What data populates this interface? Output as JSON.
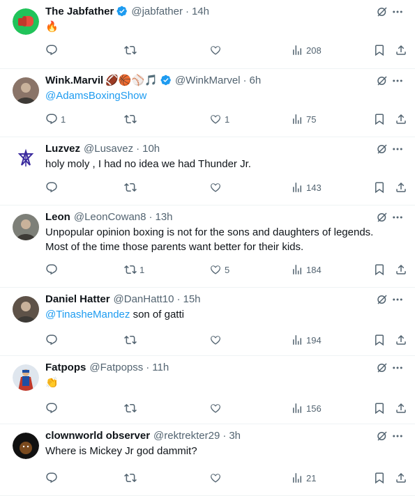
{
  "replies": [
    {
      "name": "The Jabfather",
      "verified": true,
      "handle": "@jabfather",
      "time": "14h",
      "text": [
        {
          "t": "🔥",
          "mention": false
        }
      ],
      "counts": {
        "reply": "",
        "retweet": "",
        "like": "",
        "views": "208"
      },
      "avatar_color": "#21c35a",
      "avatar_icon": "boxing-glove-icon"
    },
    {
      "name": "Wink.Marvil",
      "name_emojis": "🏈🏀⚾🎵",
      "verified": true,
      "handle": "@WinkMarvel",
      "time": "6h",
      "text": [
        {
          "t": "@AdamsBoxingShow",
          "mention": true
        }
      ],
      "counts": {
        "reply": "1",
        "retweet": "",
        "like": "1",
        "views": "75"
      },
      "avatar_color": "#8a7468",
      "avatar_icon": "photo-avatar"
    },
    {
      "name": "Luzvez",
      "verified": false,
      "handle": "@Lusavez",
      "time": "10h",
      "text": [
        {
          "t": "holy moly , I had no idea we had Thunder Jr.",
          "mention": false
        }
      ],
      "counts": {
        "reply": "",
        "retweet": "",
        "like": "",
        "views": "143"
      },
      "avatar_color": "#ffffff",
      "avatar_icon": "star-sigil-icon"
    },
    {
      "name": "Leon",
      "verified": false,
      "handle": "@LeonCowan8",
      "time": "13h",
      "text": [
        {
          "t": "Unpopular opinion boxing is not for the sons and daughters of legends. Most of the time those parents want better for their kids.",
          "mention": false
        }
      ],
      "counts": {
        "reply": "",
        "retweet": "1",
        "like": "5",
        "views": "184"
      },
      "avatar_color": "#7d7f78",
      "avatar_icon": "photo-avatar"
    },
    {
      "name": "Daniel Hatter",
      "verified": false,
      "handle": "@DanHatt10",
      "time": "15h",
      "text": [
        {
          "t": "@TinasheMandez",
          "mention": true
        },
        {
          "t": " son of gatti",
          "mention": false
        }
      ],
      "counts": {
        "reply": "",
        "retweet": "",
        "like": "",
        "views": "194"
      },
      "avatar_color": "#5e5248",
      "avatar_icon": "photo-avatar"
    },
    {
      "name": "Fatpops",
      "verified": false,
      "handle": "@Fatpopss",
      "time": "11h",
      "text": [
        {
          "t": "👏",
          "mention": false
        }
      ],
      "counts": {
        "reply": "",
        "retweet": "",
        "like": "",
        "views": "156"
      },
      "avatar_color": "#dfe6ee",
      "avatar_icon": "superhero-avatar"
    },
    {
      "name": "clownworld observer",
      "verified": false,
      "handle": "@rektrekter29",
      "time": "3h",
      "text": [
        {
          "t": "Where is Mickey Jr god dammit?",
          "mention": false
        }
      ],
      "counts": {
        "reply": "",
        "retweet": "",
        "like": "",
        "views": "21"
      },
      "avatar_color": "#111111",
      "avatar_icon": "dark-avatar"
    }
  ],
  "colors": {
    "text": "#0f1419",
    "muted": "#536471",
    "link": "#1d9bf0",
    "verified": "#1d9bf0",
    "divider": "#eff3f4"
  }
}
